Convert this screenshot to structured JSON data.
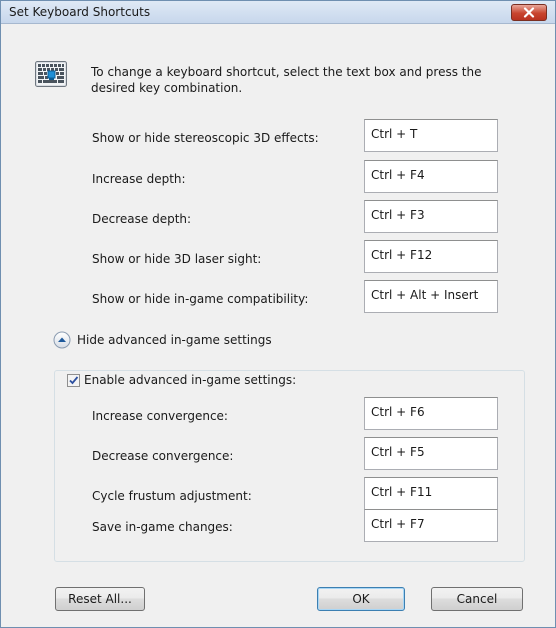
{
  "window": {
    "title": "Set Keyboard Shortcuts"
  },
  "icons": {
    "keyboard": "keyboard-icon",
    "close": "close-icon",
    "collapse": "chevron-up-icon",
    "checkmark": "checkmark-icon"
  },
  "intro": {
    "text": "To change a keyboard shortcut, select the text box and press the desired key combination."
  },
  "shortcuts": [
    {
      "label": "Show or hide stereoscopic 3D effects:",
      "value": "Ctrl + T"
    },
    {
      "label": "Increase depth:",
      "value": "Ctrl + F4"
    },
    {
      "label": "Decrease depth:",
      "value": "Ctrl + F3"
    },
    {
      "label": "Show or hide 3D laser sight:",
      "value": "Ctrl + F12"
    },
    {
      "label": "Show or hide in-game compatibility:",
      "value": "Ctrl + Alt + Insert"
    }
  ],
  "advanced": {
    "toggle_label": "Hide advanced in-game settings",
    "enable_label": "Enable advanced in-game settings:",
    "enabled": true,
    "shortcuts": [
      {
        "label": "Increase convergence:",
        "value": "Ctrl + F6"
      },
      {
        "label": "Decrease convergence:",
        "value": "Ctrl + F5"
      },
      {
        "label": "Cycle frustum adjustment:",
        "value": "Ctrl + F11"
      },
      {
        "label": "Save in-game changes:",
        "value": "Ctrl + F7"
      }
    ]
  },
  "buttons": {
    "reset": "Reset All...",
    "ok": "OK",
    "cancel": "Cancel"
  },
  "colors": {
    "close_button": "#c8452f",
    "checkmark": "#2d50a0",
    "expander_arrow": "#1f5a9c"
  }
}
